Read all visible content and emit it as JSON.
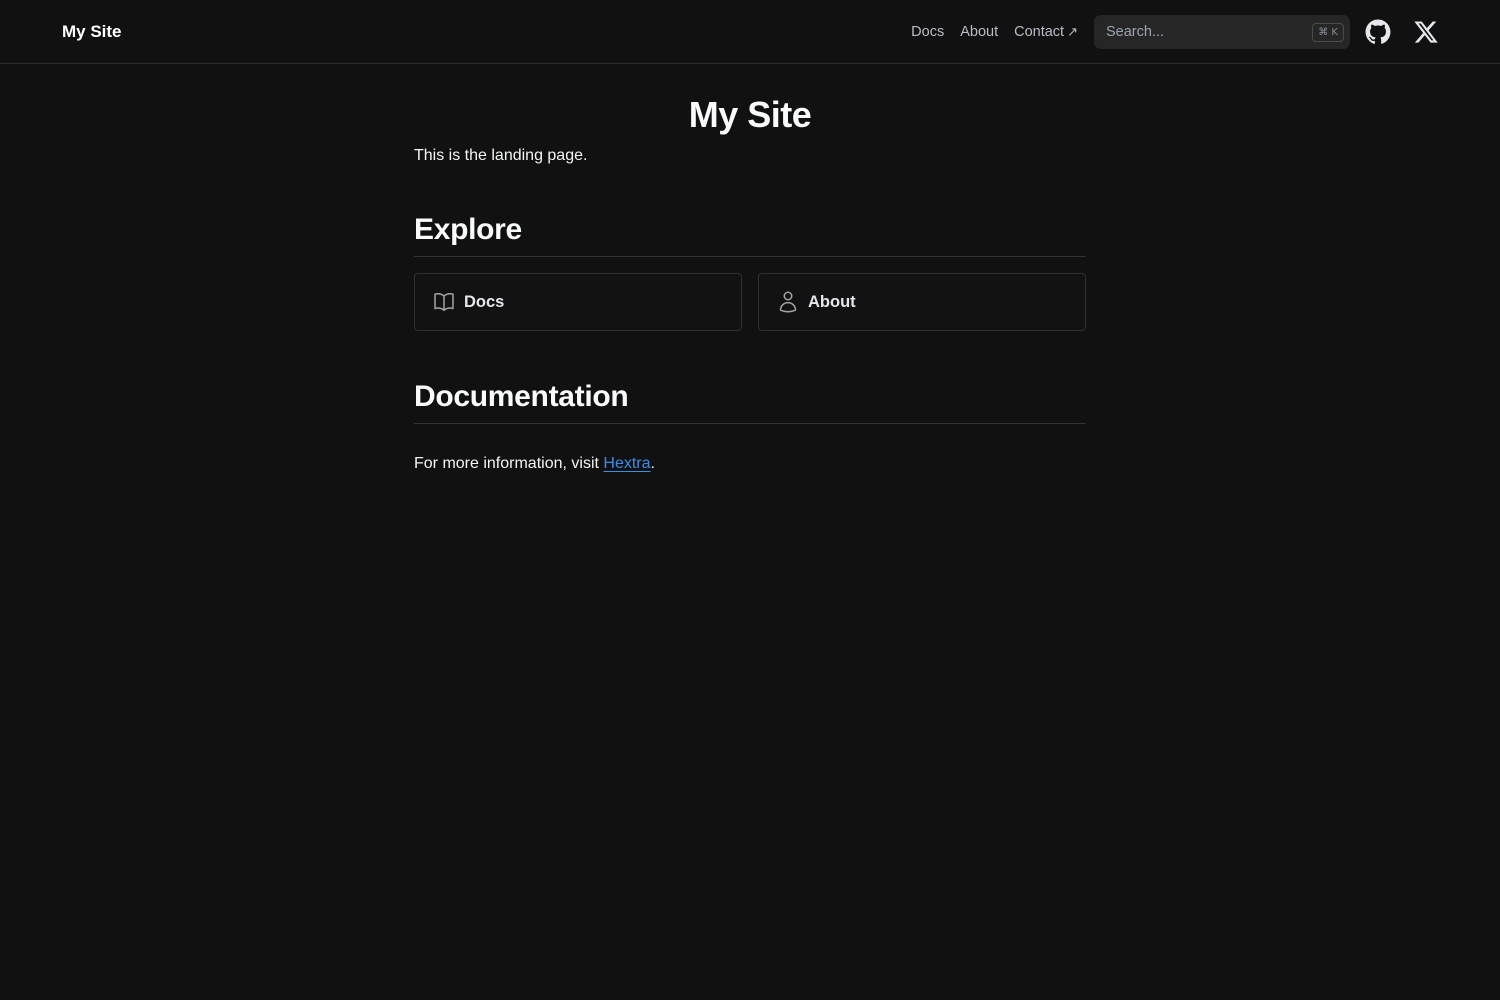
{
  "navbar": {
    "brand": "My Site",
    "links": [
      {
        "label": "Docs"
      },
      {
        "label": "About"
      },
      {
        "label": "Contact",
        "external_icon": "arrow-up-right-icon"
      }
    ],
    "search": {
      "placeholder": "Search...",
      "shortcut": "⌘ K"
    },
    "social": [
      {
        "icon": "github-icon"
      },
      {
        "icon": "x-icon"
      }
    ]
  },
  "main": {
    "title": "My Site",
    "intro": "This is the landing page.",
    "explore": {
      "heading": "Explore",
      "cards": [
        {
          "title": "Docs",
          "icon": "book-open-icon"
        },
        {
          "title": "About",
          "icon": "user-icon"
        }
      ]
    },
    "documentation": {
      "heading": "Documentation",
      "text_before": "For more information, visit ",
      "link": "Hextra",
      "text_after": "."
    }
  },
  "colors": {
    "background": "#111111",
    "text": "#f3f4f6",
    "link": "#3b8eea",
    "border": "#2f2f2f"
  }
}
